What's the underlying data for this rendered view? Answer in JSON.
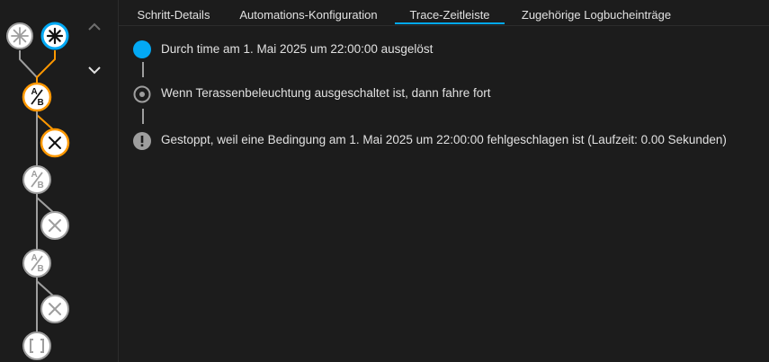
{
  "colors": {
    "accent": "#03a9f4",
    "active_path": "#ff9800",
    "inactive_node": "#9e9e9e",
    "text": "#e1e1e1",
    "panel_bg": "#1c1c1c"
  },
  "tabs": [
    {
      "label": "Schritt-Details",
      "active": false
    },
    {
      "label": "Automations-Konfiguration",
      "active": false
    },
    {
      "label": "Trace-Zeitleiste",
      "active": true
    },
    {
      "label": "Zugehörige Logbucheinträge",
      "active": false
    }
  ],
  "graph": {
    "nodes": [
      {
        "icon": "asterisk-icon",
        "state": "inactive"
      },
      {
        "icon": "asterisk-icon",
        "state": "selected"
      },
      {
        "icon": "ab-condition-icon",
        "label": "A/B",
        "state": "active"
      },
      {
        "icon": "close-icon",
        "state": "active"
      },
      {
        "icon": "ab-condition-icon",
        "label": "A/B",
        "state": "inactive"
      },
      {
        "icon": "close-icon",
        "state": "inactive"
      },
      {
        "icon": "ab-condition-icon",
        "label": "A/B",
        "state": "inactive"
      },
      {
        "icon": "close-icon",
        "state": "inactive"
      },
      {
        "icon": "brackets-icon",
        "label": "[ ]",
        "state": "inactive"
      }
    ],
    "nav": {
      "up_icon": "chevron-up-icon",
      "down_icon": "chevron-down-icon"
    }
  },
  "timeline": [
    {
      "icon": "filled-circle-icon",
      "text": "Durch time am 1. Mai 2025 um 22:00:00 ausgelöst"
    },
    {
      "icon": "radio-dot-icon",
      "text": "Wenn Terassenbeleuchtung ausgeschaltet ist, dann fahre fort"
    },
    {
      "icon": "alert-circle-icon",
      "text": "Gestoppt, weil eine Bedingung am 1. Mai 2025 um 22:00:00 fehlgeschlagen ist (Laufzeit: 0.00 Sekunden)"
    }
  ]
}
